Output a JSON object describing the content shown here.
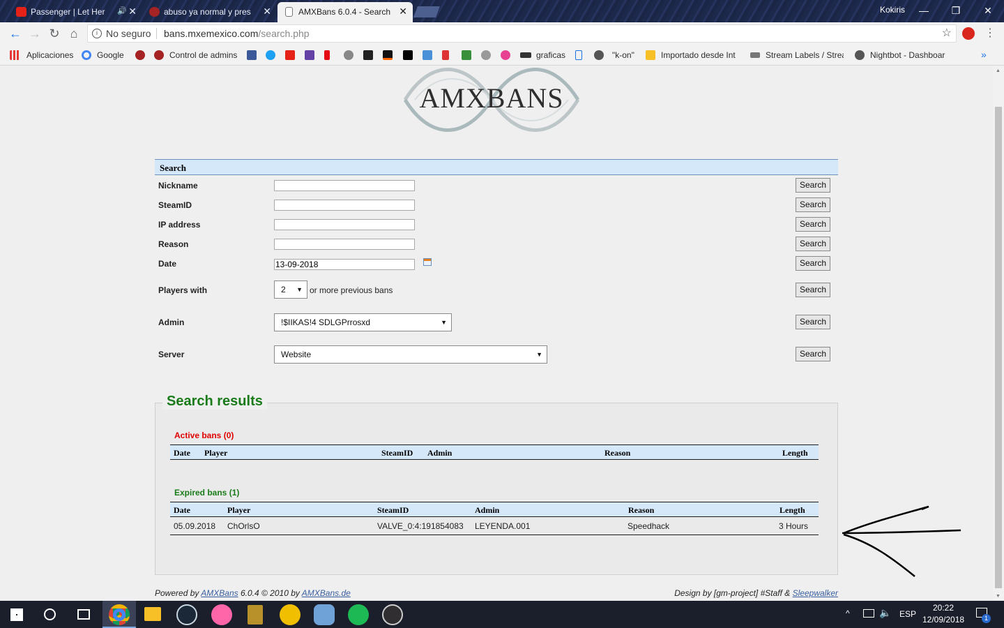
{
  "browser": {
    "tabs": [
      {
        "title": "Passenger | Let Her"
      },
      {
        "title": "abuso ya normal y pres"
      },
      {
        "title": "AMXBans 6.0.4 - Search"
      }
    ],
    "profile": "Kokiris",
    "security_label": "No seguro",
    "url_domain": "bans.mxemexico.com",
    "url_path": "/search.php",
    "bookmarks": [
      "Aplicaciones",
      "Google",
      "Control de admins",
      "graficas",
      "\"k-on\"",
      "Importado desde Int",
      "Stream Labels / Strea",
      "Nightbot - Dashboar"
    ],
    "bookmarks_more": "»"
  },
  "page": {
    "logo_text": "AMXBANS",
    "search": {
      "header": "Search",
      "button_label": "Search",
      "rows": [
        {
          "label": "Nickname",
          "value": ""
        },
        {
          "label": "SteamID",
          "value": ""
        },
        {
          "label": "IP address",
          "value": ""
        },
        {
          "label": "Reason",
          "value": ""
        },
        {
          "label": "Date",
          "value": "13-09-2018"
        }
      ],
      "players_with": {
        "label": "Players with",
        "value": "2",
        "suffix": "or more previous bans"
      },
      "admin": {
        "label": "Admin",
        "value": "!$IIKAS!4 SDLGPrrosxd"
      },
      "server": {
        "label": "Server",
        "value": "Website"
      }
    },
    "results": {
      "title": "Search results",
      "active": {
        "title": "Active bans (0)",
        "headers": [
          "Date",
          "Player",
          "SteamID",
          "Admin",
          "Reason",
          "Length"
        ]
      },
      "expired": {
        "title": "Expired bans (1)",
        "headers": [
          "Date",
          "Player",
          "SteamID",
          "Admin",
          "Reason",
          "Length"
        ],
        "rows": [
          {
            "date": "05.09.2018",
            "player": "ChOrlsO",
            "steamid": "VALVE_0:4:191854083",
            "admin": "LEYENDA.001",
            "reason": "Speedhack",
            "length": "3 Hours"
          }
        ]
      }
    },
    "footer": {
      "left_prefix": "Powered by",
      "left_link1": "AMXBans",
      "left_mid": "6.0.4 © 2010 by",
      "left_link2": "AMXBans.de",
      "right_prefix": "Design by [gm-project] #Staff &",
      "right_link": "Sleepwalker"
    }
  },
  "taskbar": {
    "language": "ESP",
    "time": "20:22",
    "date": "12/09/2018",
    "notification_count": "1"
  },
  "colors": {
    "accent_blue": "#d4e8fa",
    "results_green": "#1a7b1a",
    "active_red": "#e00000"
  }
}
